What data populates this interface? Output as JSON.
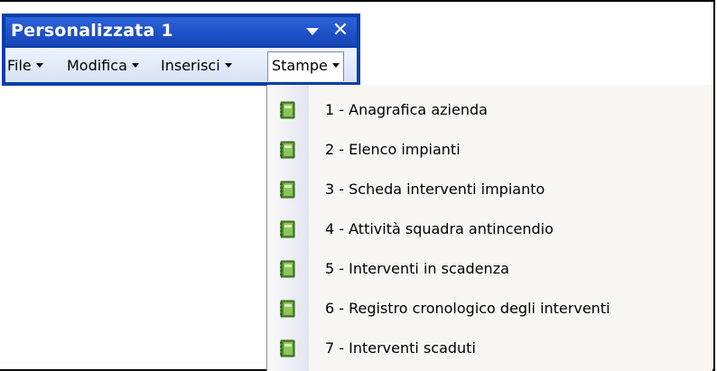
{
  "toolbar": {
    "title": "Personalizzata 1",
    "title_dropdown_icon": "triangle-down-icon",
    "close_glyph": "✕",
    "menus": [
      {
        "label": "File"
      },
      {
        "label": "Modifica"
      },
      {
        "label": "Inserisci"
      },
      {
        "label": "Stampe"
      }
    ]
  },
  "dropdown": {
    "menu": "Stampe",
    "item_icon": "report-book-icon",
    "items": [
      {
        "label": "1 - Anagrafica azienda"
      },
      {
        "label": "2 - Elenco impianti"
      },
      {
        "label": "3 - Scheda interventi impianto"
      },
      {
        "label": "4 - Attività squadra antincendio"
      },
      {
        "label": "5 - Interventi in scadenza"
      },
      {
        "label": "6 - Registro cronologico degli interventi"
      },
      {
        "label": "7 - Interventi scaduti"
      }
    ]
  },
  "colors": {
    "titlebar": "#1d4fc6",
    "toolbar_border": "#0a3fa8",
    "menubar": "#e3ebf8",
    "icon_green": "#5e9a38"
  }
}
